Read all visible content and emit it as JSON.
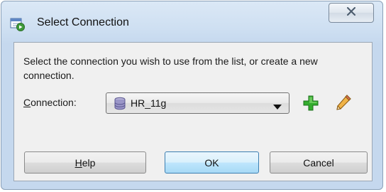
{
  "window": {
    "title": "Select Connection",
    "title_icon": "dialog-connection-icon",
    "close_icon": "close-icon"
  },
  "dialog": {
    "description": "Select the connection you wish to use from the list, or create a new connection.",
    "connection_label_first": "C",
    "connection_label_rest": "onnection:",
    "connection_value": "HR_11g",
    "connection_value_icon": "database-icon",
    "add_icon": "add-connection-icon",
    "edit_icon": "edit-connection-icon"
  },
  "buttons": {
    "help_first": "H",
    "help_rest": "elp",
    "ok": "OK",
    "cancel": "Cancel"
  },
  "colors": {
    "titlebar": "#cfe0f2",
    "content_bg": "#f0f0f0",
    "add_green": "#2fa52f",
    "pencil_orange": "#e3a03a"
  }
}
